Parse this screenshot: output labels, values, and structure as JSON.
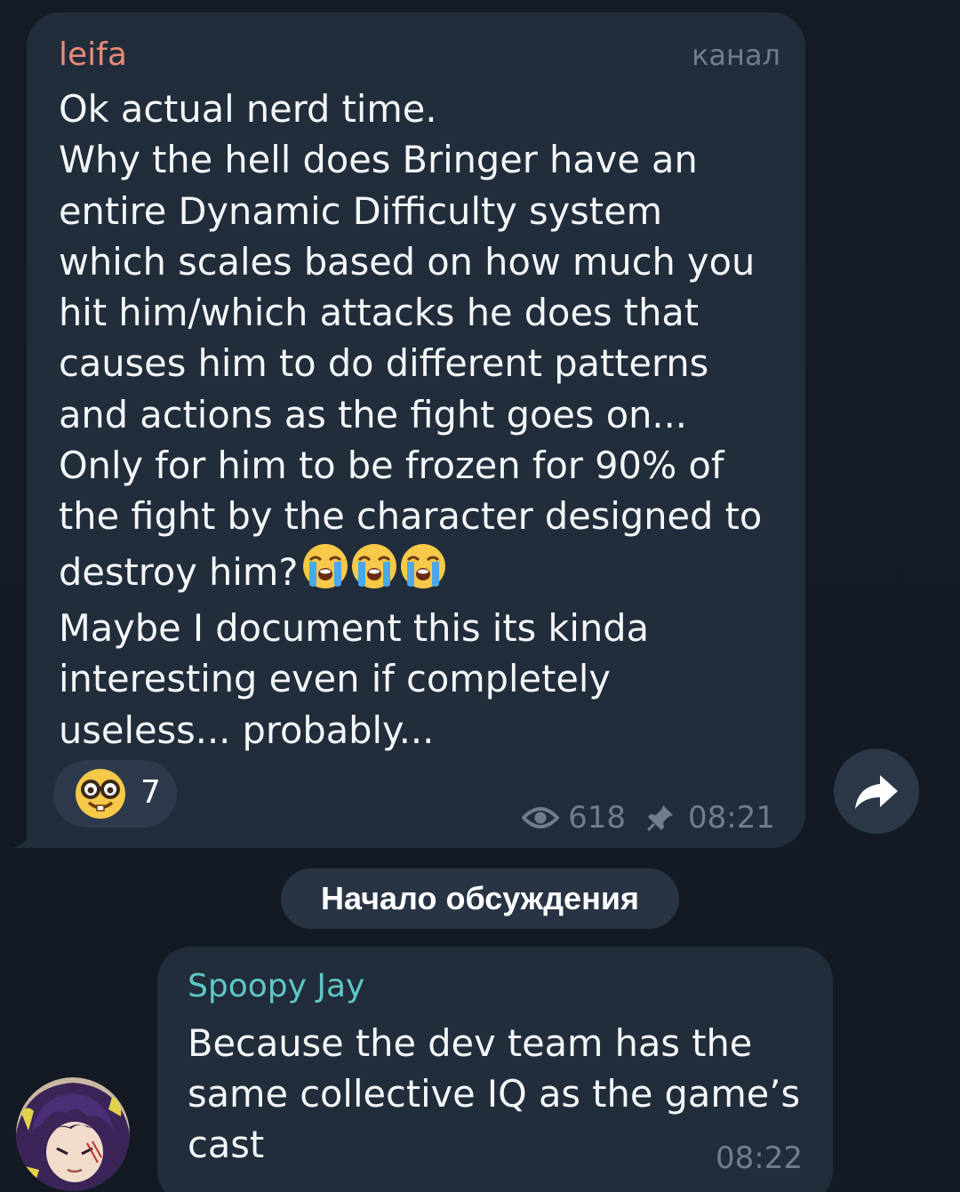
{
  "post": {
    "author": "leifa",
    "badge": "канал",
    "lines": [
      "Ok actual nerd time.",
      "Why the hell does Bringer have an",
      "entire Dynamic Difficulty system",
      "which scales based on how much you",
      "hit him/which attacks he does that",
      "causes him to do different patterns",
      "and actions as the fight goes on...",
      "Only for him to be frozen for 90% of",
      "the fight by the character designed to",
      "destroy him?",
      "Maybe I document this its kinda",
      "interesting even if completely",
      "useless... probably..."
    ],
    "line_emojis": [
      "loudly-crying-face",
      "loudly-crying-face",
      "loudly-crying-face"
    ],
    "reaction": {
      "emoji": "nerd-face",
      "count": "7"
    },
    "views": "618",
    "time": "08:21"
  },
  "share_button": {
    "icon": "share-arrow-icon"
  },
  "discussion_chip": {
    "label": "Начало обсуждения"
  },
  "reply": {
    "author": "Spoopy Jay",
    "lines": [
      "Because the dev team has the",
      "same collective IQ as the game’s",
      "cast"
    ],
    "time": "08:22"
  },
  "colors": {
    "background": "#141a24",
    "bubble": "#212d3b",
    "post_author": "#ea8a7a",
    "reply_author": "#5fc7c7",
    "meta_text": "#6f7d8c"
  }
}
